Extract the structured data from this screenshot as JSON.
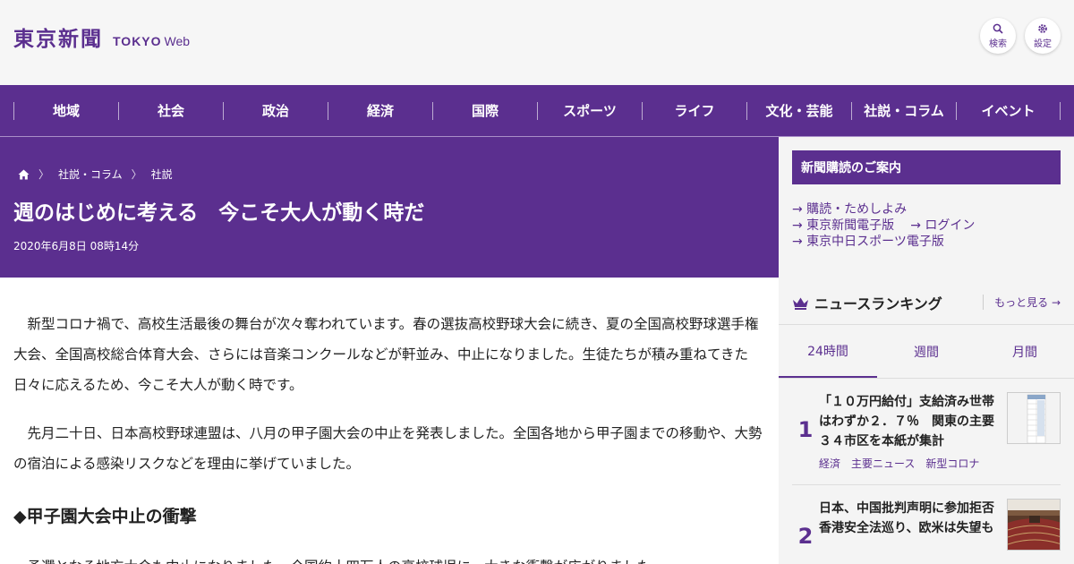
{
  "header": {
    "logo_kanji": "東京新聞",
    "logo_tokyo": "TOKYO",
    "logo_web": "Web",
    "search_label": "検索",
    "settings_label": "設定"
  },
  "nav": {
    "items": [
      "地域",
      "社会",
      "政治",
      "経済",
      "国際",
      "スポーツ",
      "ライフ",
      "文化・芸能",
      "社説・コラム",
      "イベント"
    ]
  },
  "article": {
    "breadcrumb": [
      "社説・コラム",
      "社説"
    ],
    "title": "週のはじめに考える　今こそ大人が動く時だ",
    "date": "2020年6月8日 08時14分",
    "paragraphs": [
      "新型コロナ禍で、高校生活最後の舞台が次々奪われています。春の選抜高校野球大会に続き、夏の全国高校野球選手権大会、全国高校総合体育大会、さらには音楽コンクールなどが軒並み、中止になりました。生徒たちが積み重ねてきた日々に応えるため、今こそ大人が動く時です。",
      "先月二十日、日本高校野球連盟は、八月の甲子園大会の中止を発表しました。全国各地から甲子園までの移動や、大勢の宿泊による感染リスクなどを理由に挙げていました。",
      "予選となる地方大会も中止になりました。全国約十四万人の高校球児に、大きな衝撃が広がりました。"
    ],
    "subhead": "◆甲子園大会中止の衝撃"
  },
  "sidebar": {
    "subscribe_title": "新聞購読のご案内",
    "links": [
      "→ 購読・ためしよみ",
      "→ 東京新聞電子版",
      "→ ログイン",
      "→ 東京中日スポーツ電子版"
    ],
    "ranking_title": "ニュースランキング",
    "ranking_more": "もっと見る →",
    "tabs": [
      "24時間",
      "週間",
      "月間"
    ],
    "items": [
      {
        "rank": "1",
        "title": "「１０万円給付」支給済み世帯はわずか２．７％　関東の主要３４市区を本紙が集計",
        "tags": [
          "経済",
          "主要ニュース",
          "新型コロナ"
        ]
      },
      {
        "rank": "2",
        "title": "日本、中国批判声明に参加拒否　香港安全法巡り、欧米は失望も",
        "tags": []
      }
    ]
  }
}
